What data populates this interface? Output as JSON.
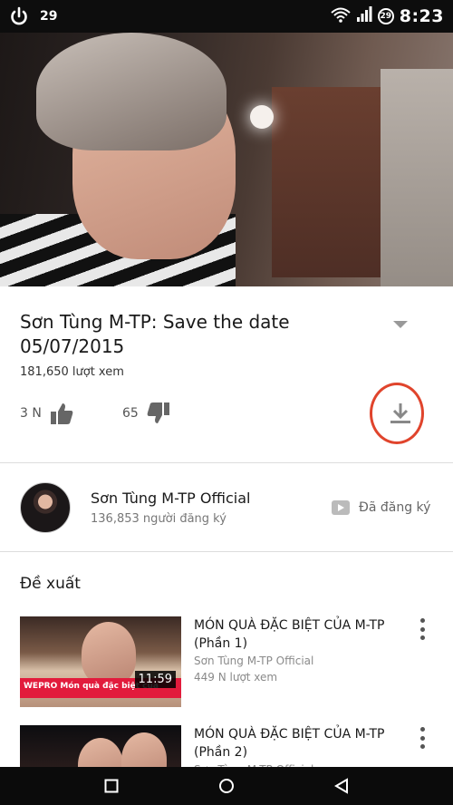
{
  "status_bar": {
    "notification_count": "29",
    "badge": "29",
    "time": "8:23"
  },
  "video": {
    "title": "Sơn Tùng M-TP: Save the date 05/07/2015",
    "views": "181,650 lượt xem",
    "likes": "3 N",
    "dislikes": "65"
  },
  "channel": {
    "name": "Sơn Tùng M-TP Official",
    "subscribers": "136,853 người đăng ký",
    "subscribe_label": "Đã đăng ký"
  },
  "suggestions": {
    "header": "Đề xuất",
    "items": [
      {
        "title": "MÓN QUÀ ĐẶC BIỆT CỦA M-TP (Phần 1)",
        "channel": "Sơn Tùng M-TP Official",
        "views": "449 N lượt xem",
        "duration": "11:59",
        "banner": "WEPRO  Món quà đặc biệt của"
      },
      {
        "title": "MÓN QUÀ ĐẶC BIỆT CỦA M-TP (Phần 2)",
        "channel": "Sơn Tùng M-TP Official"
      }
    ]
  },
  "colors": {
    "accent_red": "#e0442c",
    "status_bar": "#0d0d0d"
  }
}
